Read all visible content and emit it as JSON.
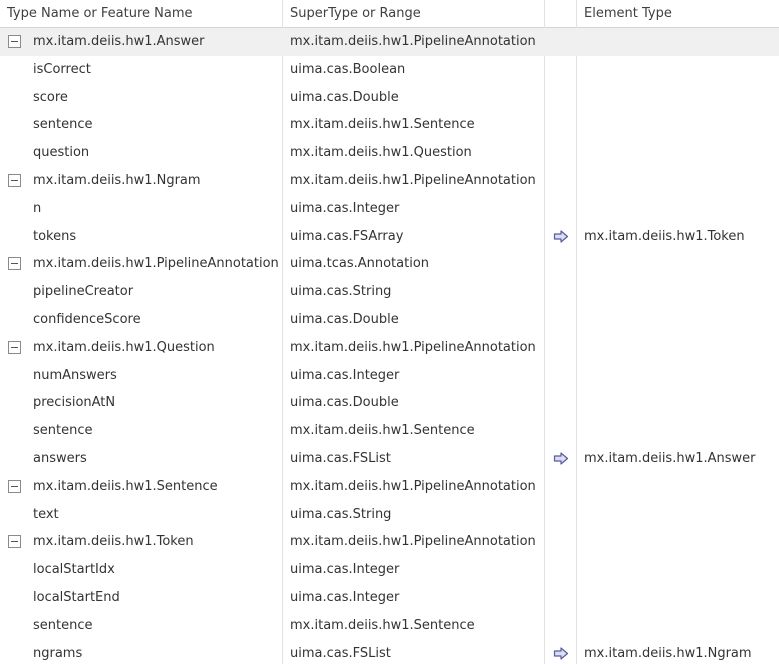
{
  "columns": {
    "name": "Type Name or Feature Name",
    "super": "SuperType or Range",
    "arrow": "",
    "element": "Element Type"
  },
  "colors": {
    "arrow_fill": "#dcdcf4",
    "arrow_stroke": "#5a5a9c",
    "selected_row": "#f0f0f0"
  },
  "rows": [
    {
      "kind": "type",
      "name": "mx.itam.deiis.hw1.Answer",
      "super": "mx.itam.deiis.hw1.PipelineAnnotation",
      "element": "",
      "selected": true
    },
    {
      "kind": "feature",
      "name": "isCorrect",
      "super": "uima.cas.Boolean",
      "element": ""
    },
    {
      "kind": "feature",
      "name": "score",
      "super": "uima.cas.Double",
      "element": ""
    },
    {
      "kind": "feature",
      "name": "sentence",
      "super": "mx.itam.deiis.hw1.Sentence",
      "element": ""
    },
    {
      "kind": "feature",
      "name": "question",
      "super": "mx.itam.deiis.hw1.Question",
      "element": ""
    },
    {
      "kind": "type",
      "name": "mx.itam.deiis.hw1.Ngram",
      "super": "mx.itam.deiis.hw1.PipelineAnnotation",
      "element": ""
    },
    {
      "kind": "feature",
      "name": "n",
      "super": "uima.cas.Integer",
      "element": ""
    },
    {
      "kind": "feature",
      "name": "tokens",
      "super": "uima.cas.FSArray",
      "element": "mx.itam.deiis.hw1.Token",
      "arrow_icon": "right-arrow-icon"
    },
    {
      "kind": "type",
      "name": "mx.itam.deiis.hw1.PipelineAnnotation",
      "super": "uima.tcas.Annotation",
      "element": ""
    },
    {
      "kind": "feature",
      "name": "pipelineCreator",
      "super": "uima.cas.String",
      "element": ""
    },
    {
      "kind": "feature",
      "name": "confidenceScore",
      "super": "uima.cas.Double",
      "element": ""
    },
    {
      "kind": "type",
      "name": "mx.itam.deiis.hw1.Question",
      "super": "mx.itam.deiis.hw1.PipelineAnnotation",
      "element": ""
    },
    {
      "kind": "feature",
      "name": "numAnswers",
      "super": "uima.cas.Integer",
      "element": ""
    },
    {
      "kind": "feature",
      "name": "precisionAtN",
      "super": "uima.cas.Double",
      "element": ""
    },
    {
      "kind": "feature",
      "name": "sentence",
      "super": "mx.itam.deiis.hw1.Sentence",
      "element": ""
    },
    {
      "kind": "feature",
      "name": "answers",
      "super": "uima.cas.FSList",
      "element": "mx.itam.deiis.hw1.Answer",
      "arrow_icon": "right-arrow-icon"
    },
    {
      "kind": "type",
      "name": "mx.itam.deiis.hw1.Sentence",
      "super": "mx.itam.deiis.hw1.PipelineAnnotation",
      "element": ""
    },
    {
      "kind": "feature",
      "name": "text",
      "super": "uima.cas.String",
      "element": ""
    },
    {
      "kind": "type",
      "name": "mx.itam.deiis.hw1.Token",
      "super": "mx.itam.deiis.hw1.PipelineAnnotation",
      "element": ""
    },
    {
      "kind": "feature",
      "name": "localStartIdx",
      "super": "uima.cas.Integer",
      "element": ""
    },
    {
      "kind": "feature",
      "name": "localStartEnd",
      "super": "uima.cas.Integer",
      "element": ""
    },
    {
      "kind": "feature",
      "name": "sentence",
      "super": "mx.itam.deiis.hw1.Sentence",
      "element": ""
    },
    {
      "kind": "feature",
      "name": "ngrams",
      "super": "uima.cas.FSList",
      "element": "mx.itam.deiis.hw1.Ngram",
      "arrow_icon": "right-arrow-icon"
    }
  ]
}
